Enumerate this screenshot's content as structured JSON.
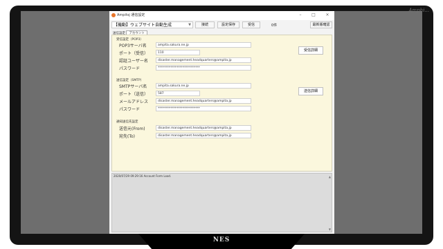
{
  "brand": "Amphi...",
  "stand_label": "NES",
  "window": {
    "title": "Ampitsj 通信設定",
    "minimize": "–",
    "maximize": "□",
    "close": "×"
  },
  "toolbar": {
    "site_select": "【機動】ウェブサイト自動生成",
    "connect": "接続",
    "save_settings": "設定保存",
    "mail": "受信",
    "count": "0件",
    "version": "最新版確認"
  },
  "tabs": {
    "label": "送信設定",
    "active": "アカウント"
  },
  "receive": {
    "header": "受信設定（POP3）",
    "server_label": "POP3サーバ名",
    "server_value": "ampita.sakura.ne.jp",
    "port_label": "ポート（受信）",
    "port_value": "110",
    "user_label": "認証ユーザー名",
    "user_value": "disaster.management.headquarters@ampita.jp",
    "password_label": "パスワード",
    "password_value": "***************************",
    "detail_button": "受信詳細"
  },
  "send": {
    "header": "送信設定（SMTP）",
    "server_label": "SMTPサーバ名",
    "server_value": "ampita.sakura.ne.jp",
    "port_label": "ポート（送信）",
    "port_value": "587",
    "mail_label": "メールアドレス",
    "mail_value": "disaster.management.headquarters@ampita.jp",
    "password_label": "パスワード",
    "password_value": "***************************",
    "detail_button": "送信詳細"
  },
  "notify": {
    "header": "通知送信先設定",
    "from_label": "送信元(From)",
    "from_value": "disaster.management.headquarters@ampita.jp",
    "to_label": "宛先(To)",
    "to_value": "disaster.management.headquarters@ampita.jp"
  },
  "log": {
    "line": "2020/07/29 09:29:16 Account Form Load."
  }
}
